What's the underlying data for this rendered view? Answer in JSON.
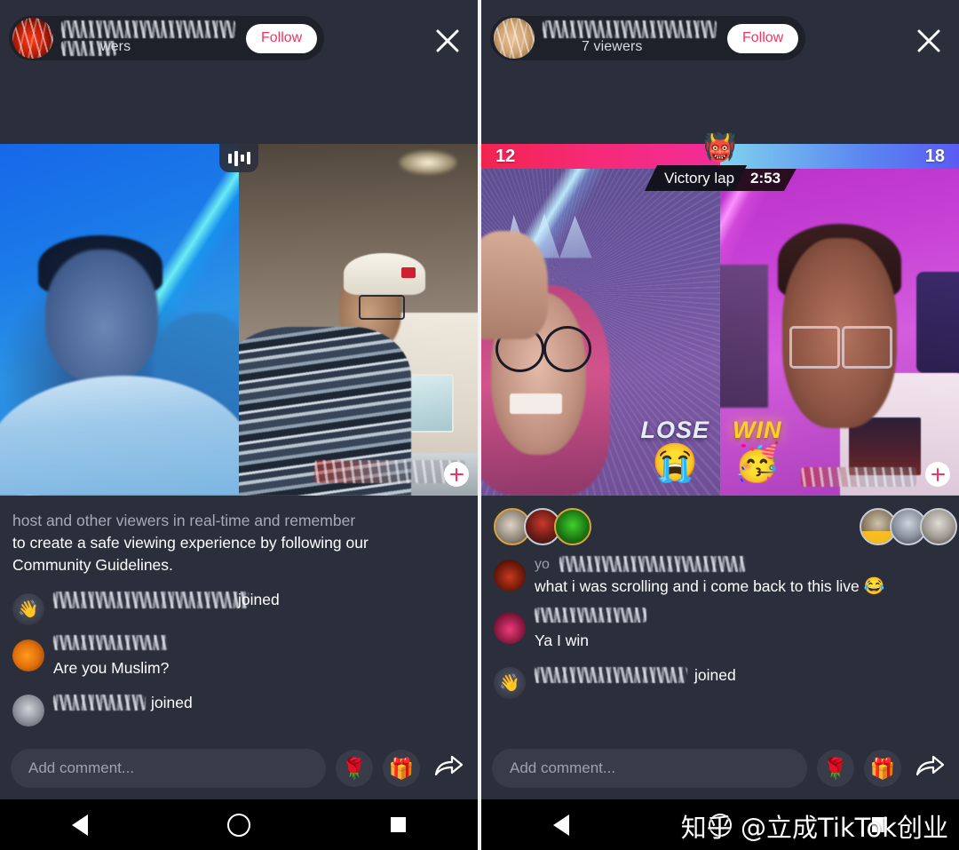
{
  "app": {
    "platform": "TikTok LIVE",
    "accent_pink": "#f4345f",
    "panel_bg": "#2b2e3b",
    "input_bg": "#383b48"
  },
  "panels": [
    {
      "id": "left-live",
      "header": {
        "follow_label": "Follow",
        "viewer_text": "wers",
        "username_redacted": true,
        "close_icon": "close-icon"
      },
      "stage": {
        "audio_badge_icon": "equalizer-icon",
        "follow_plus_icon": "plus-icon",
        "cams": [
          {
            "id": "cam-guest-left",
            "desc": "blue-led-bedroom"
          },
          {
            "id": "cam-guest-right",
            "desc": "kitchen-cap-striped-sweater"
          }
        ]
      },
      "chat": {
        "system_message": {
          "lines": [
            "host and other viewers in real-time and remember",
            "to create a safe viewing experience by following our",
            "Community Guidelines."
          ]
        },
        "messages": [
          {
            "avatar": "wave-hand",
            "name_redacted": true,
            "action": "joined",
            "text": ""
          },
          {
            "avatar": "orange",
            "name_redacted": true,
            "action": "",
            "text": "Are you Muslim?"
          },
          {
            "avatar": "grey",
            "name_redacted": true,
            "action": "joined",
            "text": ""
          }
        ]
      },
      "composer": {
        "placeholder": "Add comment...",
        "rose_icon": "rose-icon",
        "gift_icon": "gift-icon",
        "share_icon": "share-arrow-icon"
      },
      "navbar": {
        "back": "back-triangle-icon",
        "home": "home-circle-icon",
        "recents": "recents-square-icon"
      }
    },
    {
      "id": "right-live-battle",
      "header": {
        "follow_label": "Follow",
        "viewer_text": "7 viewers",
        "username_redacted": true,
        "close_icon": "close-icon"
      },
      "battle": {
        "left_score": "12",
        "right_score": "18",
        "stage_label": "Victory lap",
        "timer": "2:53",
        "mascot_icon": "angry-face-mascot-icon",
        "left_gradient": [
          "#f1244f",
          "#f22c9a"
        ],
        "right_gradient": [
          "#7fd3ef",
          "#5a5cf2"
        ]
      },
      "stage": {
        "follow_plus_icon": "plus-icon",
        "cams": [
          {
            "id": "cam-battle-left",
            "desc": "purple-led-glasses-pink-hair",
            "verdict": "LOSE",
            "verdict_emoji": "😭",
            "verdict_color": "#e7ecfb"
          },
          {
            "id": "cam-battle-right",
            "desc": "magenta-led-glasses-white-tee",
            "verdict": "WIN",
            "verdict_emoji": "🥳",
            "verdict_color": "#ffce2b"
          }
        ]
      },
      "viewer_row": {
        "left_avatars": [
          "viewer-1",
          "viewer-2",
          "viewer-3"
        ],
        "right_avatars": [
          "top-viewer-1",
          "top-viewer-2",
          "top-viewer-3"
        ]
      },
      "chat": {
        "messages": [
          {
            "avatar": "reddark",
            "name_prefix": "yo",
            "name_redacted": true,
            "action": "",
            "text": "what i was scrolling and i come back to this live",
            "emoji": "😂"
          },
          {
            "avatar": "pinkdark",
            "name_redacted": true,
            "action": "",
            "text": "Ya I win"
          },
          {
            "avatar": "wave-hand",
            "name_redacted": true,
            "action": "joined",
            "text": ""
          }
        ]
      },
      "composer": {
        "placeholder": "Add comment...",
        "rose_icon": "rose-icon",
        "gift_icon": "gift-icon",
        "share_icon": "share-arrow-icon"
      },
      "navbar": {
        "back": "back-triangle-icon",
        "home": "home-circle-icon",
        "recents": "recents-square-icon"
      },
      "watermark": "知乎 @立成TikTok创业"
    }
  ]
}
